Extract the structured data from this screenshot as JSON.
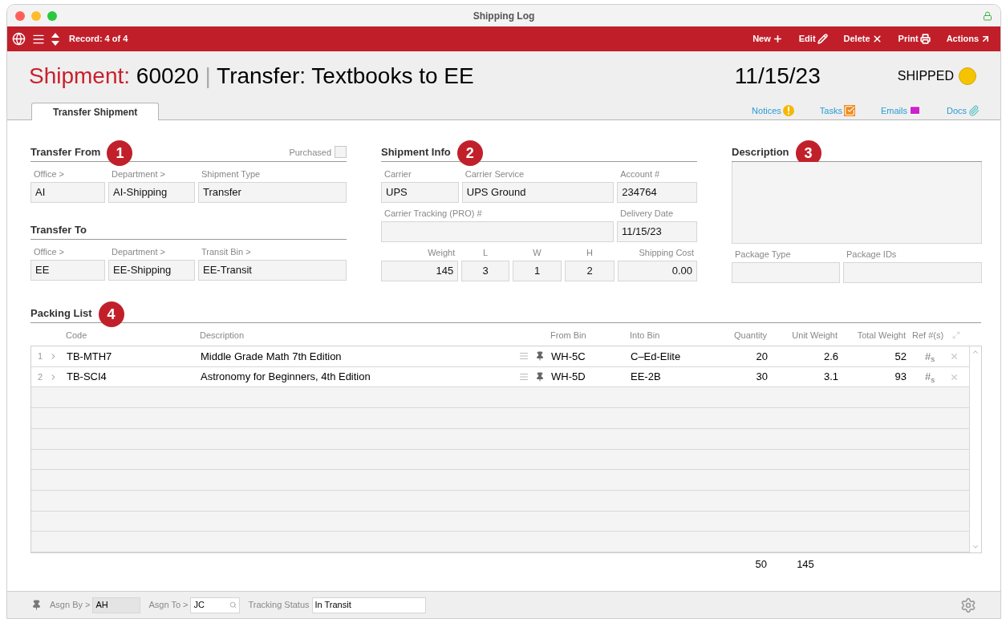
{
  "window": {
    "title": "Shipping Log"
  },
  "toolbar": {
    "record": "Record: 4 of 4",
    "actions": [
      {
        "label": "New",
        "kind": "new"
      },
      {
        "label": "Edit",
        "kind": "edit"
      },
      {
        "label": "Delete",
        "kind": "delete"
      },
      {
        "label": "Print",
        "kind": "print"
      },
      {
        "label": "Actions",
        "kind": "actions"
      }
    ]
  },
  "header": {
    "prefix": "Shipment:",
    "number": "60020",
    "separator": "|",
    "title": "Transfer: Textbooks to EE",
    "date": "11/15/23",
    "status": "SHIPPED"
  },
  "tabs": [
    {
      "label": "Transfer Shipment",
      "selected": true
    }
  ],
  "links": [
    {
      "label": "Notices",
      "kind": "notices"
    },
    {
      "label": "Tasks",
      "kind": "tasks"
    },
    {
      "label": "Emails",
      "kind": "emails"
    },
    {
      "label": "Docs",
      "kind": "docs"
    }
  ],
  "transfer_from": {
    "title": "Transfer From",
    "badge": "1",
    "purchased": {
      "label": "Purchased",
      "checked": false
    },
    "fields": [
      {
        "label": "Office >",
        "value": "AI"
      },
      {
        "label": "Department >",
        "value": "AI-Shipping"
      },
      {
        "label": "Shipment Type",
        "value": "Transfer"
      }
    ]
  },
  "transfer_to": {
    "title": "Transfer To",
    "fields": [
      {
        "label": "Office >",
        "value": "EE"
      },
      {
        "label": "Department >",
        "value": "EE-Shipping"
      },
      {
        "label": "Transit Bin >",
        "value": "EE-Transit"
      }
    ]
  },
  "shipment_info": {
    "title": "Shipment Info",
    "badge": "2",
    "fields": [
      {
        "label": "Carrier",
        "value": "UPS"
      },
      {
        "label": "Carrier Service",
        "value": "UPS Ground"
      },
      {
        "label": "Account #",
        "value": "234764"
      },
      {
        "label": "Carrier Tracking (PRO) #"
      },
      {
        "label": "Delivery Date",
        "value": "11/15/23"
      },
      {
        "label": "Weight",
        "value": "145"
      },
      {
        "label": "L",
        "value": "3"
      },
      {
        "label": "W",
        "value": "1"
      },
      {
        "label": "H",
        "value": "2"
      },
      {
        "label": "Shipping Cost",
        "value": "0.00"
      }
    ]
  },
  "description": {
    "title": "Description",
    "badge": "3",
    "fields": [
      {
        "label": "Package Type"
      },
      {
        "label": "Package IDs"
      }
    ]
  },
  "packing_list": {
    "title": "Packing List",
    "badge": "4",
    "columns": [
      "Code",
      "Description",
      "From Bin",
      "Into Bin",
      "Quantity",
      "Unit Weight",
      "Total Weight",
      "Ref #(s)"
    ],
    "rows": [
      {
        "number": "1",
        "code": "TB-MTH7",
        "description": "Middle Grade Math 7th Edition",
        "from_bin": "WH-5C",
        "into_bin": "C–Ed-Elite",
        "quantity": "20",
        "unit_weight": "2.6",
        "total_weight": "52",
        "ref": "#$_{s}$"
      },
      {
        "number": "2",
        "code": "TB-SCI4",
        "description": "Astronomy for Beginners, 4th Edition",
        "from_bin": "WH-5D",
        "into_bin": "EE-2B",
        "quantity": "30",
        "unit_weight": "3.1",
        "total_weight": "93",
        "ref": "#$_{s}$"
      }
    ],
    "totals": {
      "quantity": "50",
      "total_2": "145"
    }
  },
  "footer": {
    "fields": [
      {
        "label": "Asgn By >",
        "value": "AH",
        "kind": "plain"
      },
      {
        "label": "Asgn To >",
        "value": "JC",
        "kind": "lookup"
      },
      {
        "label": "Tracking Status",
        "value": "In Transit",
        "kind": "input"
      }
    ]
  }
}
